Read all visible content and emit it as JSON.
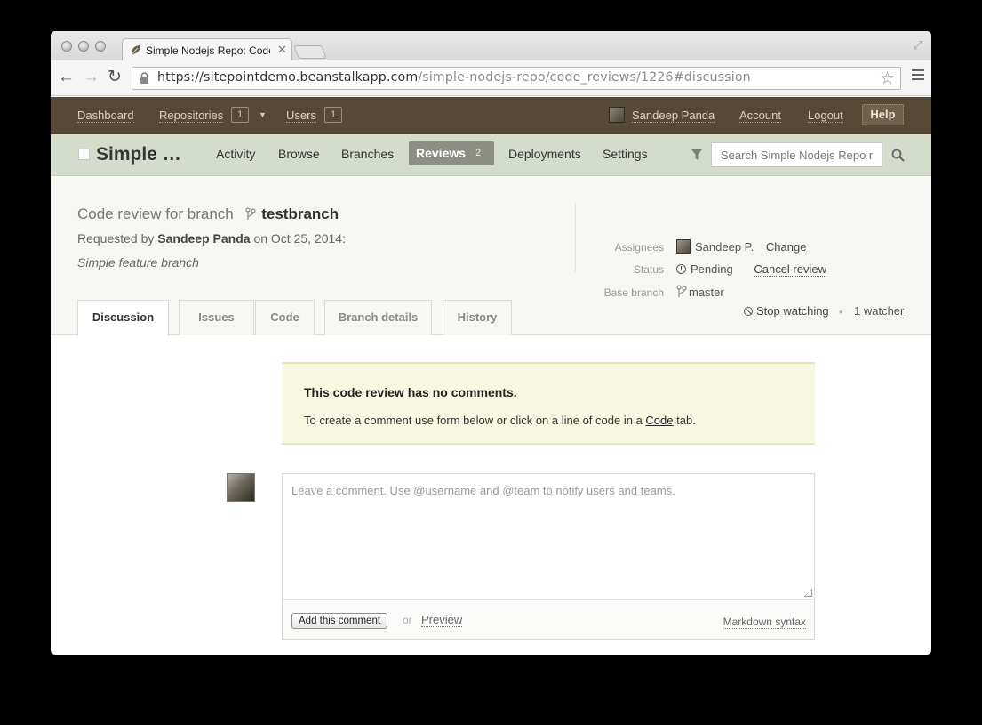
{
  "browser": {
    "tab_title": "Simple Nodejs Repo: Code",
    "url_host": "https://sitepointdemo.beanstalkapp.com",
    "url_path": "/simple-nodejs-repo/code_reviews/1226#discussion"
  },
  "topnav": {
    "dashboard": "Dashboard",
    "repositories": "Repositories",
    "repositories_count": "1",
    "users": "Users",
    "users_count": "1",
    "user_name": "Sandeep Panda",
    "account": "Account",
    "logout": "Logout",
    "help": "Help"
  },
  "repo_nav": {
    "repo_name": "Simple …",
    "activity": "Activity",
    "browse": "Browse",
    "branches": "Branches",
    "reviews": "Reviews",
    "reviews_count": "2",
    "deployments": "Deployments",
    "settings": "Settings",
    "search_placeholder": "Search Simple Nodejs Repo r"
  },
  "review": {
    "title_prefix": "Code review for branch",
    "branch": "testbranch",
    "requested_prefix": "Requested by",
    "requester": "Sandeep Panda",
    "requested_suffix": "on Oct 25, 2014:",
    "description": "Simple feature branch",
    "assignees_label": "Assignees",
    "assignee": "Sandeep P.",
    "change": "Change",
    "status_label": "Status",
    "status": "Pending",
    "cancel_review": "Cancel review",
    "base_branch_label": "Base branch",
    "base_branch": "master"
  },
  "tabs": {
    "discussion": "Discussion",
    "issues": "Issues",
    "code": "Code",
    "branch_details": "Branch details",
    "history": "History"
  },
  "watch": {
    "stop_watching": "Stop watching",
    "watchers": "1 watcher"
  },
  "notice": {
    "title": "This code review has no comments.",
    "text_before": "To create a comment use form below or click on a line of code in a",
    "code_link": "Code",
    "text_after": "tab."
  },
  "comment": {
    "placeholder": "Leave a comment. Use @username and @team to notify users and teams.",
    "add_button": "Add this comment",
    "or": "or",
    "preview": "Preview",
    "markdown": "Markdown syntax"
  },
  "colors": {
    "topnav_bg": "#564a37",
    "repnav_bg": "#d4dccc",
    "reviews_tab_bg": "#8d8e84",
    "notice_bg": "#f7f8df"
  }
}
